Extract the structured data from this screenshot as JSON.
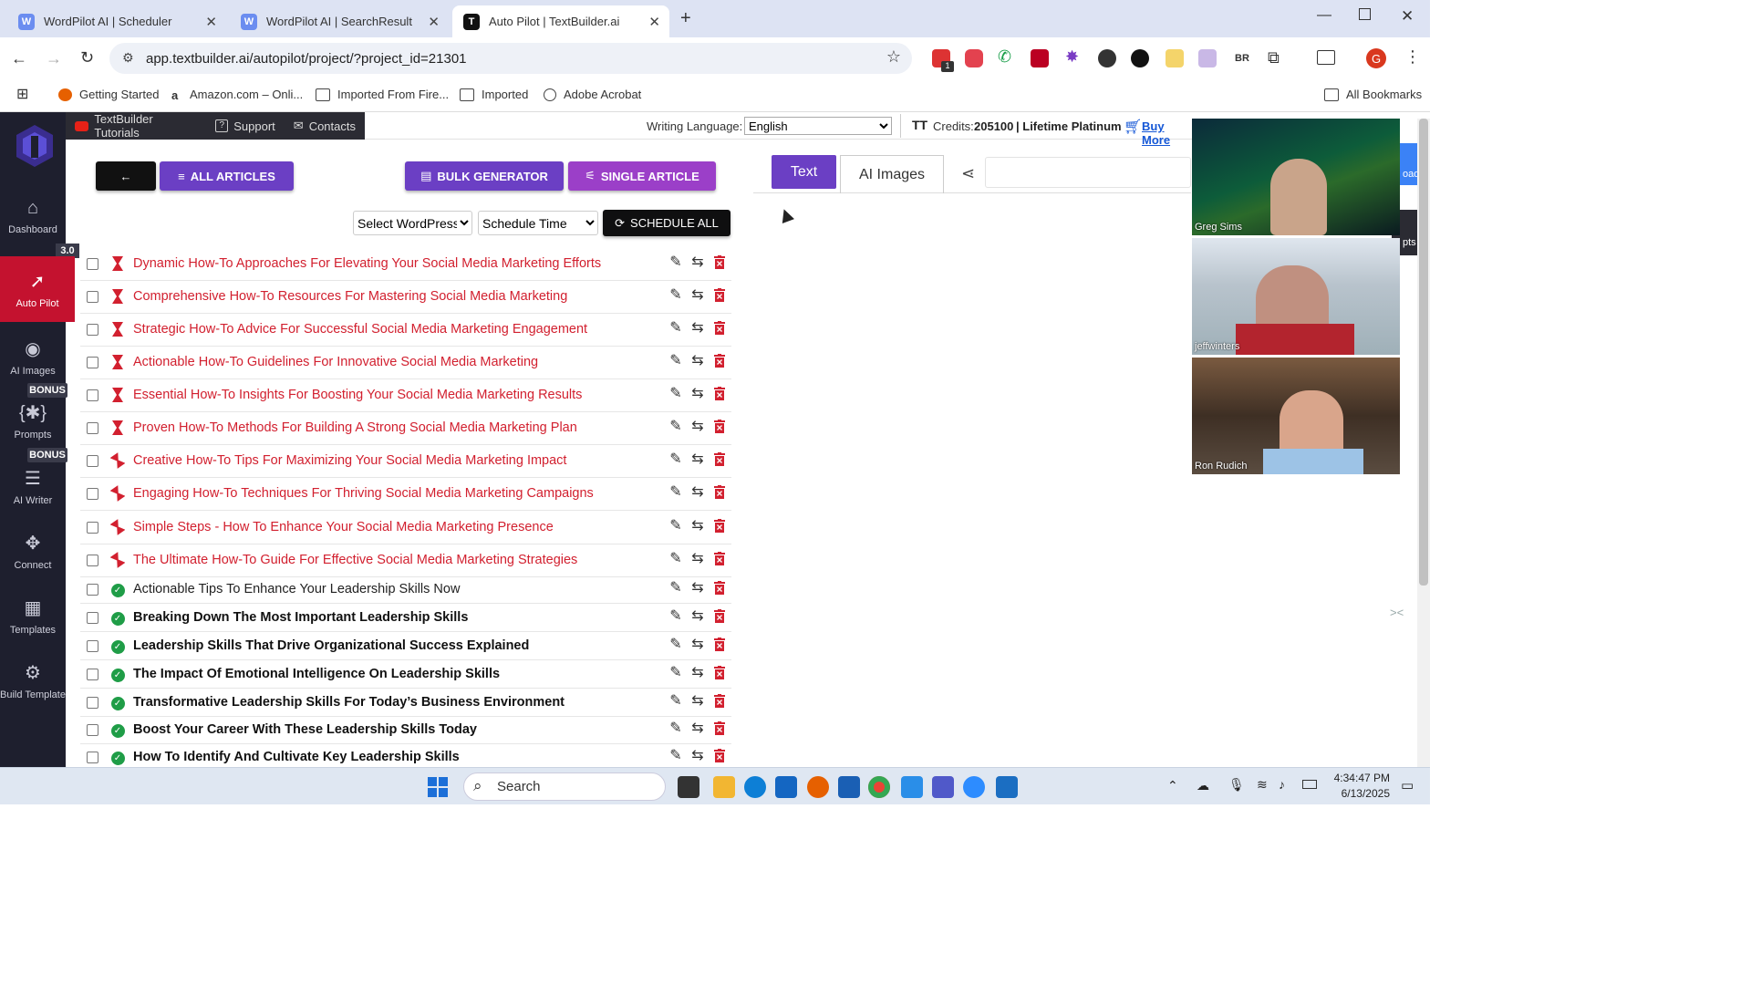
{
  "browser": {
    "tabs": [
      {
        "title": "WordPilot AI | Scheduler",
        "active": false
      },
      {
        "title": "WordPilot AI | SearchResult",
        "active": false
      },
      {
        "title": "Auto Pilot | TextBuilder.ai",
        "active": true
      }
    ],
    "url": "app.textbuilder.ai/autopilot/project/?project_id=21301",
    "bookmarks": [
      "Getting Started",
      "Amazon.com – Onli...",
      "Imported From Fire...",
      "Imported",
      "Adobe Acrobat"
    ],
    "all_bookmarks": "All Bookmarks",
    "profile_initial": "G",
    "ext_badge": "1",
    "ext_br": "BR"
  },
  "sidebar": {
    "version_badge": "3.0",
    "bonus_label": "BONUS",
    "items": [
      {
        "label": "Dashboard",
        "icon": "home-icon"
      },
      {
        "label": "Auto Pilot",
        "icon": "rocket-icon"
      },
      {
        "label": "AI Images",
        "icon": "camera-icon"
      },
      {
        "label": "Prompts",
        "icon": "gear-brackets-icon"
      },
      {
        "label": "AI Writer",
        "icon": "writer-icon"
      },
      {
        "label": "Connect",
        "icon": "move-icon"
      },
      {
        "label": "Templates",
        "icon": "grid-icon"
      },
      {
        "label": "Build Template",
        "icon": "settings-icon"
      }
    ]
  },
  "topbar": {
    "tutorials": "TextBuilder Tutorials",
    "support": "Support",
    "contacts": "Contacts",
    "writing_language_label": "Writing Language:",
    "writing_language": "English",
    "credits_label": "Credits:",
    "credits_value": "205100",
    "plan": "| Lifetime Platinum",
    "buy_more": "Buy More"
  },
  "toolbar": {
    "back": "←",
    "all_articles": "ALL ARTICLES",
    "bulk_generator": "BULK GENERATOR",
    "single_article": "SINGLE ARTICLE",
    "select_wordpress": "Select WordPress",
    "schedule_time": "Schedule Time",
    "schedule_all": "SCHEDULE ALL"
  },
  "articles": [
    {
      "title": "Dynamic How-To Approaches For Elevating Your Social Media Marketing Efforts",
      "status": "pending"
    },
    {
      "title": "Comprehensive How-To Resources For Mastering Social Media Marketing",
      "status": "pending"
    },
    {
      "title": "Strategic How-To Advice For Successful Social Media Marketing Engagement",
      "status": "pending"
    },
    {
      "title": "Actionable How-To Guidelines For Innovative Social Media Marketing",
      "status": "pending"
    },
    {
      "title": "Essential How-To Insights For Boosting Your Social Media Marketing Results",
      "status": "pending"
    },
    {
      "title": "Proven How-To Methods For Building A Strong Social Media Marketing Plan",
      "status": "pending"
    },
    {
      "title": "Creative How-To Tips For Maximizing Your Social Media Marketing Impact",
      "status": "processing"
    },
    {
      "title": "Engaging How-To Techniques For Thriving Social Media Marketing Campaigns",
      "status": "processing"
    },
    {
      "title": "Simple Steps - How To Enhance Your Social Media Marketing Presence",
      "status": "processing"
    },
    {
      "title": "The Ultimate How-To Guide For Effective Social Media Marketing Strategies",
      "status": "processing"
    },
    {
      "title": "Actionable Tips To Enhance Your Leadership Skills Now",
      "status": "done-normal"
    },
    {
      "title": "Breaking Down The Most Important Leadership Skills",
      "status": "done"
    },
    {
      "title": "Leadership Skills That Drive Organizational Success Explained",
      "status": "done"
    },
    {
      "title": "The Impact Of Emotional Intelligence On Leadership Skills",
      "status": "done"
    },
    {
      "title": "Transformative Leadership Skills For Today’s Business Environment",
      "status": "done"
    },
    {
      "title": "Boost Your Career With These Leadership Skills Today",
      "status": "done"
    },
    {
      "title": "How To Identify And Cultivate Key Leadership Skills",
      "status": "done"
    }
  ],
  "right_panel": {
    "tab_text": "Text",
    "tab_images": "AI Images",
    "cut_load": "oad",
    "cut_pts": "pts"
  },
  "video": {
    "participants": [
      "Greg Sims",
      "jeffwinters",
      "Ron Rudich"
    ]
  },
  "taskbar": {
    "search_placeholder": "Search",
    "time": "4:34:47 PM",
    "date": "6/13/2025"
  },
  "colors": {
    "brand_red": "#c4122f",
    "purple": "#6b3fc4",
    "magenta": "#9b3fc8",
    "title_red": "#d2202f",
    "done_green": "#1f9d47"
  }
}
